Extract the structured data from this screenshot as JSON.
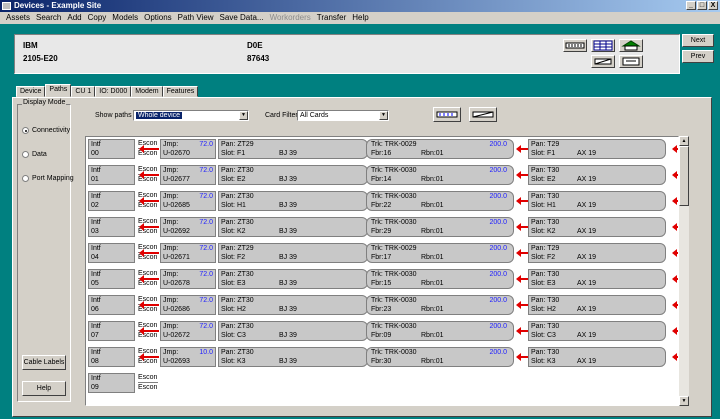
{
  "window": {
    "title": "Devices - Example Site",
    "controls": [
      "_",
      "□",
      "X"
    ]
  },
  "menu": [
    "Assets",
    "Search",
    "Add",
    "Copy",
    "Models",
    "Options",
    "Path View",
    "Save Data...",
    "Workorders",
    "Transfer",
    "Help"
  ],
  "menu_disabled": [
    false,
    false,
    false,
    false,
    false,
    false,
    false,
    false,
    true,
    false,
    false
  ],
  "header": {
    "vendor": "IBM",
    "model": "2105-E20",
    "device_id": "D0E",
    "serial": "87643"
  },
  "nav": {
    "next": "Next",
    "prev": "Prev"
  },
  "tabs": [
    "Device",
    "Paths",
    "CU 1",
    "IO: D000",
    "Modem",
    "Features"
  ],
  "active_tab": "Paths",
  "display_mode": {
    "title": "Display Mode",
    "options": [
      "Connectivity",
      "Data",
      "Port Mapping"
    ],
    "selected": "Connectivity",
    "cable_labels": "Cable Labels",
    "help": "Help"
  },
  "filters": {
    "show_paths_label": "Show paths",
    "show_paths_value": "Whole device",
    "card_filter_label": "Card Filter:",
    "card_filter_value": "All Cards"
  },
  "rows": [
    {
      "intf": "00",
      "escon": [
        "Escon",
        "Escon ("
      ],
      "jmp": "U-02670",
      "jv": "72.0",
      "pan1": "Pan: ZT29",
      "slot1": "Slot: F1",
      "bj": "BJ 39",
      "trk": "Trk: TRK-0029",
      "tv": "200.0",
      "fbr": "Fbr:16",
      "rbn": "Rbn:01",
      "pan2": "Pan: T29",
      "slot2": "Slot: F1",
      "ax": "AX 19"
    },
    {
      "intf": "01",
      "escon": [
        "Escon",
        "Escon ("
      ],
      "jmp": "U-02677",
      "jv": "72.0",
      "pan1": "Pan: ZT30",
      "slot1": "Slot: E2",
      "bj": "BJ 39",
      "trk": "Trk: TRK-0030",
      "tv": "200.0",
      "fbr": "Fbr:14",
      "rbn": "Rbn:01",
      "pan2": "Pan: T30",
      "slot2": "Slot: E2",
      "ax": "AX 19"
    },
    {
      "intf": "02",
      "escon": [
        "Escon",
        "Escon ("
      ],
      "jmp": "U-02685",
      "jv": "72.0",
      "pan1": "Pan: ZT30",
      "slot1": "Slot: H1",
      "bj": "BJ 39",
      "trk": "Trk: TRK-0030",
      "tv": "200.0",
      "fbr": "Fbr:22",
      "rbn": "Rbn:01",
      "pan2": "Pan: T30",
      "slot2": "Slot: H1",
      "ax": "AX 19"
    },
    {
      "intf": "03",
      "escon": [
        "Escon",
        "Escon ("
      ],
      "jmp": "U-02692",
      "jv": "72.0",
      "pan1": "Pan: ZT30",
      "slot1": "Slot: K2",
      "bj": "BJ 39",
      "trk": "Trk: TRK-0030",
      "tv": "200.0",
      "fbr": "Fbr:29",
      "rbn": "Rbn:01",
      "pan2": "Pan: T30",
      "slot2": "Slot: K2",
      "ax": "AX 19"
    },
    {
      "intf": "04",
      "escon": [
        "Escon",
        "Escon ("
      ],
      "jmp": "U-02671",
      "jv": "72.0",
      "pan1": "Pan: ZT29",
      "slot1": "Slot: F2",
      "bj": "BJ 39",
      "trk": "Trk: TRK-0029",
      "tv": "200.0",
      "fbr": "Fbr:17",
      "rbn": "Rbn:01",
      "pan2": "Pan: T29",
      "slot2": "Slot: F2",
      "ax": "AX 19"
    },
    {
      "intf": "05",
      "escon": [
        "Escon",
        "Escon ("
      ],
      "jmp": "U-02678",
      "jv": "72.0",
      "pan1": "Pan: ZT30",
      "slot1": "Slot: E3",
      "bj": "BJ 39",
      "trk": "Trk: TRK-0030",
      "tv": "200.0",
      "fbr": "Fbr:15",
      "rbn": "Rbn:01",
      "pan2": "Pan: T30",
      "slot2": "Slot: E3",
      "ax": "AX 19"
    },
    {
      "intf": "06",
      "escon": [
        "Escon",
        "Escon ("
      ],
      "jmp": "U-02686",
      "jv": "72.0",
      "pan1": "Pan: ZT30",
      "slot1": "Slot: H2",
      "bj": "BJ 39",
      "trk": "Trk: TRK-0030",
      "tv": "200.0",
      "fbr": "Fbr:23",
      "rbn": "Rbn:01",
      "pan2": "Pan: T30",
      "slot2": "Slot: H2",
      "ax": "AX 19"
    },
    {
      "intf": "07",
      "escon": [
        "Escon",
        "Escon ("
      ],
      "jmp": "U-02672",
      "jv": "72.0",
      "pan1": "Pan: ZT30",
      "slot1": "Slot: C3",
      "bj": "BJ 39",
      "trk": "Trk: TRK-0030",
      "tv": "200.0",
      "fbr": "Fbr:09",
      "rbn": "Rbn:01",
      "pan2": "Pan: T30",
      "slot2": "Slot: C3",
      "ax": "AX 19"
    },
    {
      "intf": "08",
      "escon": [
        "Escon",
        "Escon ("
      ],
      "jmp": "U-02693",
      "jv": "10.0",
      "pan1": "Pan: ZT30",
      "slot1": "Slot: K3",
      "bj": "BJ 39",
      "trk": "Trk: TRK-0030",
      "tv": "200.0",
      "fbr": "Fbr:30",
      "rbn": "Rbn:01",
      "pan2": "Pan: T30",
      "slot2": "Slot: K3",
      "ax": "AX 19"
    },
    {
      "intf": "09",
      "escon": [
        "Escon",
        "Escon ("
      ]
    }
  ],
  "labels": {
    "intf": "Intf",
    "jmp": "Jmp:"
  },
  "colors": {
    "accent": "#008080",
    "titlebar": "#0a246a",
    "arrow": "#e00000",
    "value": "#2020ff"
  },
  "icons": [
    "patch-panel-icon",
    "grid-icon",
    "network-icon",
    "cable-icon",
    "path-icon",
    "print-path-icon",
    "export-path-icon"
  ]
}
